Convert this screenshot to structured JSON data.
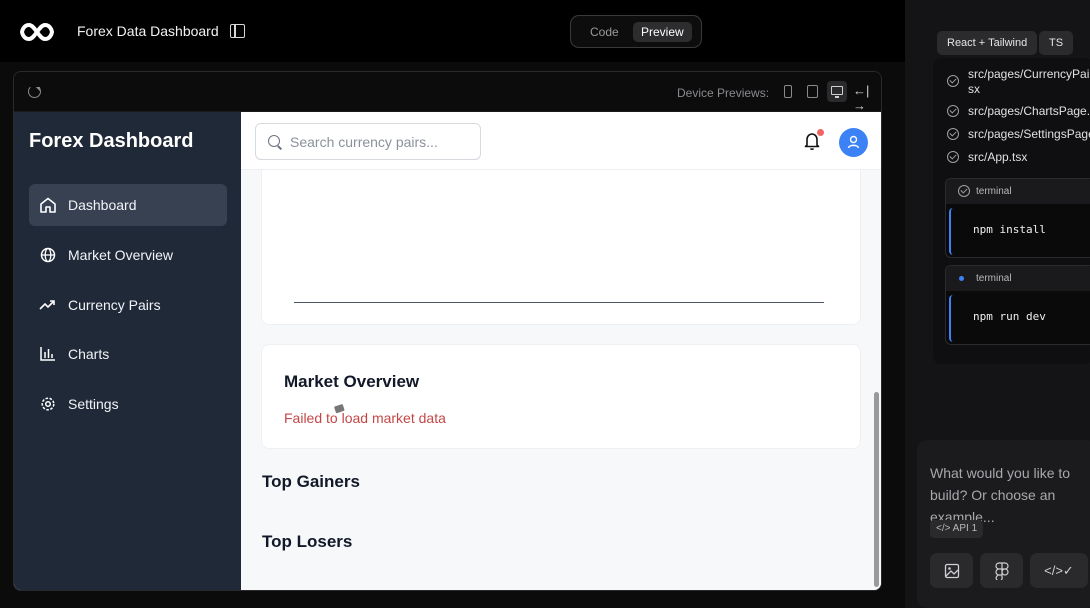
{
  "topbar": {
    "app_title": "Forex Data Dashboard",
    "mode_code": "Code",
    "mode_preview": "Preview"
  },
  "preview_bar": {
    "device_label": "Device Previews:"
  },
  "app": {
    "sidebar_title": "Forex Dashboard",
    "nav": [
      {
        "label": "Dashboard",
        "icon": "home-icon",
        "active": true
      },
      {
        "label": "Market Overview",
        "icon": "globe-icon",
        "active": false
      },
      {
        "label": "Currency Pairs",
        "icon": "trending-up-icon",
        "active": false
      },
      {
        "label": "Charts",
        "icon": "bar-chart-icon",
        "active": false
      },
      {
        "label": "Settings",
        "icon": "gear-icon",
        "active": false
      }
    ],
    "search_placeholder": "Search currency pairs...",
    "market_overview": {
      "title": "Market Overview",
      "error": "Failed to load market data"
    },
    "top_gainers": "Top Gainers",
    "top_losers": "Top Losers"
  },
  "right_panel": {
    "chips": [
      "React + Tailwind",
      "TS"
    ],
    "files": [
      "src/pages/CurrencyPairs.tsx",
      "src/pages/ChartsPage.tsx",
      "src/pages/SettingsPage.tsx",
      "src/App.tsx"
    ],
    "file_first_wrap": "sx",
    "terminals": [
      {
        "label": "terminal",
        "command": "npm install"
      },
      {
        "label": "terminal",
        "command": "npm run dev"
      }
    ],
    "prompt": "What would you like to build? Or choose an example...",
    "api_chip": "</> API 1"
  },
  "colors": {
    "sidebar_bg": "#1f2937",
    "active_nav": "#374151",
    "error_red": "#c44747",
    "avatar_blue": "#3b82f6",
    "notify_dot": "#ef6464"
  }
}
